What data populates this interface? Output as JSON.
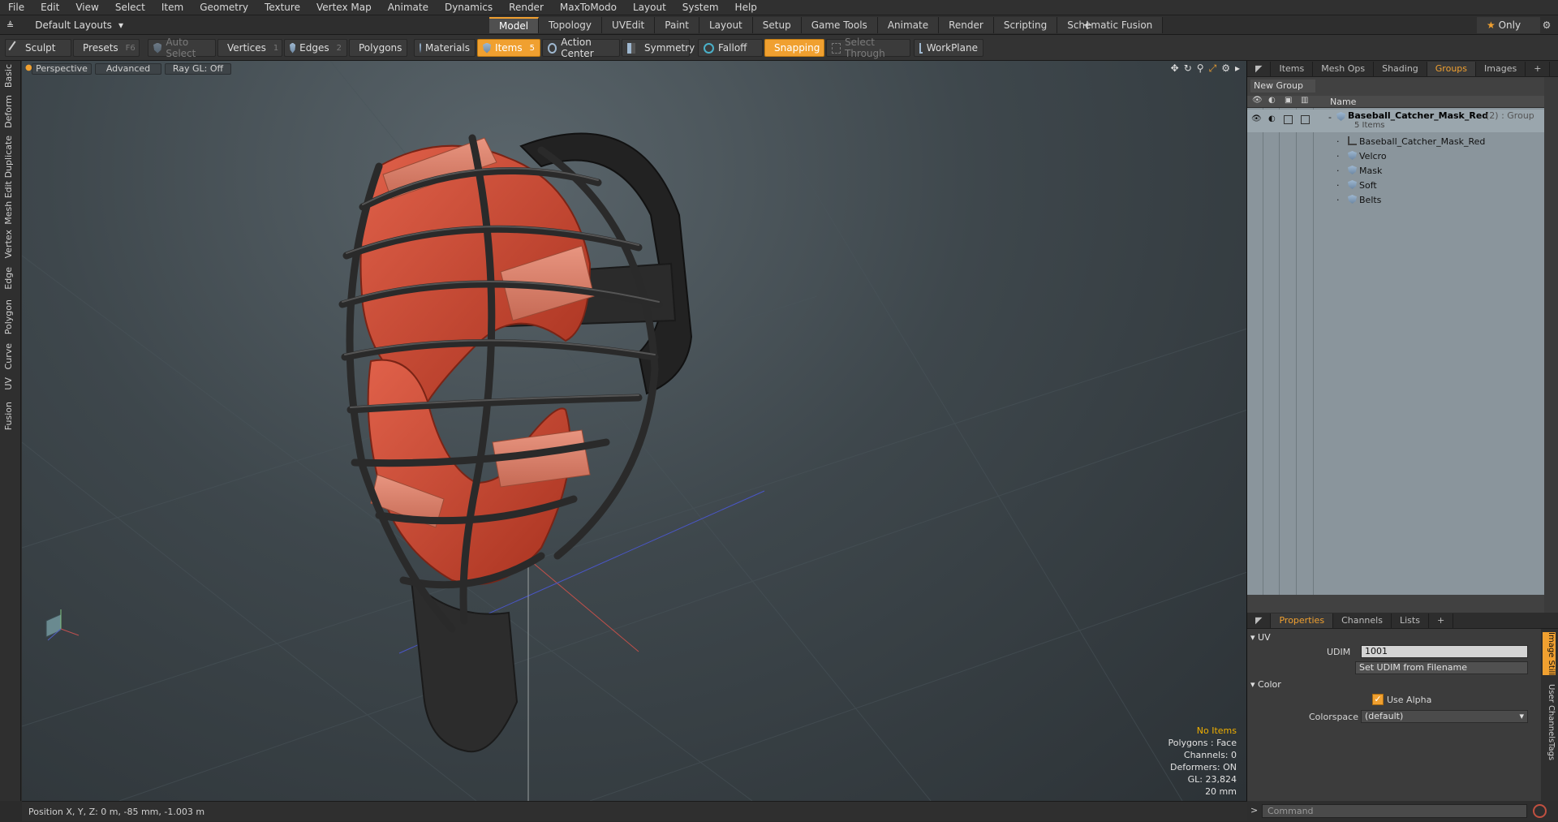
{
  "menu": [
    "File",
    "Edit",
    "View",
    "Select",
    "Item",
    "Geometry",
    "Texture",
    "Vertex Map",
    "Animate",
    "Dynamics",
    "Render",
    "MaxToModo",
    "Layout",
    "System",
    "Help"
  ],
  "layout": {
    "label": "Default Layouts",
    "arrow": "▾"
  },
  "layout_tabs": [
    "Model",
    "Topology",
    "UVEdit",
    "Paint",
    "Layout",
    "Setup",
    "Game Tools",
    "Animate",
    "Render",
    "Scripting",
    "Schematic Fusion"
  ],
  "active_layout_tab": "Model",
  "add_tab": "+",
  "only_label": "Only",
  "toolbar": {
    "sculpt": "Sculpt",
    "presets": "Presets",
    "presets_key": "F6",
    "auto_select": "Auto Select",
    "vertices": "Vertices",
    "vertices_n": "1",
    "edges": "Edges",
    "edges_n": "2",
    "polygons": "Polygons",
    "materials": "Materials",
    "items": "Items",
    "items_n": "5",
    "action_center": "Action Center",
    "symmetry": "Symmetry",
    "falloff": "Falloff",
    "snapping": "Snapping",
    "select_through": "Select Through",
    "workplane": "WorkPlane"
  },
  "left_tabs": [
    "Basic",
    "Deform",
    "Duplicate",
    "Mesh Edit",
    "Vertex",
    "Edge",
    "Polygon",
    "Curve",
    "UV",
    "Fusion"
  ],
  "viewport": {
    "view": "Perspective",
    "shading": "Advanced",
    "raygl": "Ray GL: Off",
    "stats": {
      "items": "No Items",
      "polygons": "Polygons : Face",
      "channels": "Channels: 0",
      "deformers": "Deformers: ON",
      "gl": "GL: 23,824",
      "scale": "20 mm"
    }
  },
  "status": "Position X, Y, Z:   0 m, -85 mm, -1.003 m",
  "groups_panel": {
    "tabs": [
      "Items",
      "Mesh Ops",
      "Shading",
      "Groups",
      "Images"
    ],
    "active_tab": "Groups",
    "new_group": "New Group",
    "col_name": "Name",
    "root": {
      "name": "Baseball_Catcher_Mask_Red",
      "suffix": "(2) : Group",
      "count": "5 Items"
    },
    "children": [
      "Baseball_Catcher_Mask_Red",
      "Velcro",
      "Mask",
      "Soft",
      "Belts"
    ]
  },
  "properties_panel": {
    "tabs": [
      "Properties",
      "Channels",
      "Lists"
    ],
    "active_tab": "Properties",
    "uv_section": "UV",
    "udim_label": "UDIM",
    "udim_value": "1001",
    "set_udim": "Set UDIM from Filename",
    "color_section": "Color",
    "use_alpha": "Use Alpha",
    "colorspace_label": "Colorspace",
    "colorspace_value": "(default)",
    "side_tabs": [
      "Image Still",
      "User Channels",
      "Tags"
    ]
  },
  "command_placeholder": "Command",
  "colors": {
    "accent": "#f0a030",
    "pad": "#d04a36",
    "cage": "#2a2a2a"
  }
}
